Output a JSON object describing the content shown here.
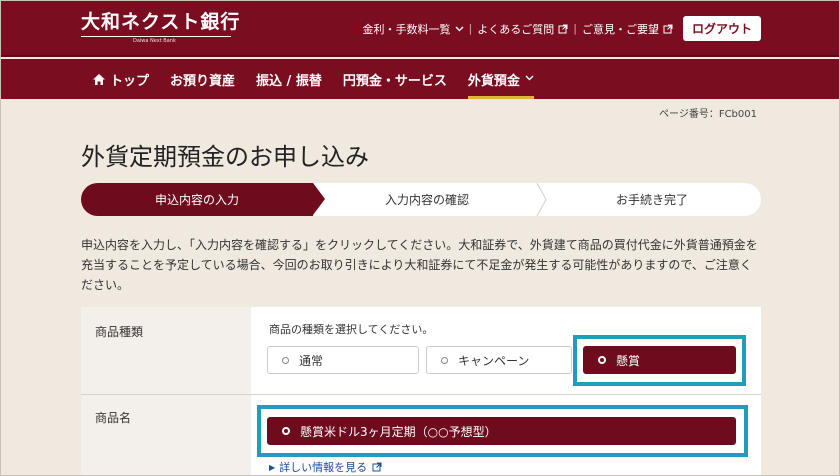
{
  "header": {
    "bank_name": "大和ネクスト銀行",
    "bank_name_en": "Daiwa Next Bank",
    "util_links": [
      {
        "label": "金利・手数料一覧",
        "icon": "chevron-down-icon"
      },
      {
        "label": "よくあるご質問",
        "icon": "external-link-icon"
      },
      {
        "label": "ご意見・ご要望",
        "icon": "external-link-icon"
      }
    ],
    "logout_label": "ログアウト"
  },
  "nav": {
    "items": [
      {
        "label": "トップ",
        "icon": "home-icon"
      },
      {
        "label": "お預り資産"
      },
      {
        "label": "振込 / 振替"
      },
      {
        "label": "円預金・サービス"
      },
      {
        "label": "外貨預金",
        "icon": "chevron-down-icon",
        "active": true
      }
    ]
  },
  "page": {
    "page_number": "ページ番号：FCb001",
    "title": "外貨定期預金のお申し込み"
  },
  "steps": [
    {
      "label": "申込内容の入力",
      "active": true
    },
    {
      "label": "入力内容の確認",
      "active": false
    },
    {
      "label": "お手続き完了",
      "active": false
    }
  ],
  "description": "申込内容を入力し、「入力内容を確認する」をクリックしてください。大和証券で、外貨建て商品の買付代金に外貨普通預金を充当することを予定している場合、今回のお取り引きにより大和証券にて不足金が発生する可能性がありますので、ご注意ください。",
  "form": {
    "product_type": {
      "label": "商品種類",
      "instruction": "商品の種類を選択してください。",
      "options": [
        {
          "label": "通常",
          "selected": false
        },
        {
          "label": "キャンペーン",
          "selected": false
        },
        {
          "label": "懸賞",
          "selected": true
        }
      ]
    },
    "product_name": {
      "label": "商品名",
      "option": {
        "label": "懸賞米ドル3ヶ月定期（○○予想型）",
        "selected": true
      },
      "detail_link": "詳しい情報を見る"
    }
  },
  "colors": {
    "brand": "#7a0d1f",
    "selected": "#6e0c1d",
    "highlight": "#1f9dbd",
    "background": "#efe9df",
    "accent": "#e0b43c"
  }
}
